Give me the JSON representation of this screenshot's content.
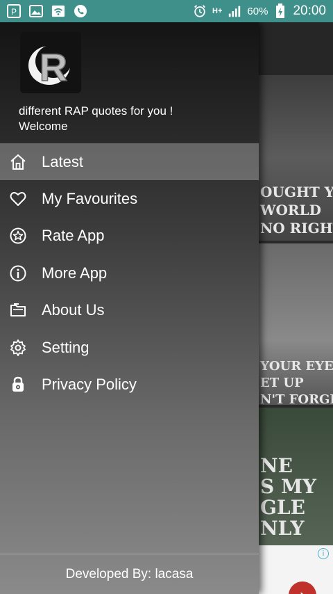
{
  "status_bar": {
    "battery_percent": "60%",
    "time": "20:00",
    "network": "H+"
  },
  "drawer": {
    "header": {
      "line1": "different RAP quotes for you !",
      "line2": "Welcome"
    },
    "menu": [
      {
        "label": "Latest",
        "icon": "home-icon",
        "active": true
      },
      {
        "label": "My Favourites",
        "icon": "heart-icon",
        "active": false
      },
      {
        "label": "Rate App",
        "icon": "star-icon",
        "active": false
      },
      {
        "label": "More App",
        "icon": "info-icon",
        "active": false
      },
      {
        "label": "About Us",
        "icon": "folder-icon",
        "active": false
      },
      {
        "label": "Setting",
        "icon": "gear-icon",
        "active": false
      },
      {
        "label": "Privacy Policy",
        "icon": "lock-icon",
        "active": false
      }
    ],
    "footer": "Developed By: lacasa"
  },
  "background_content": {
    "quote1": [
      "OUGHT YOU",
      "WORLD",
      "NO RIGHT"
    ],
    "quote2": [
      "YOUR EYES,",
      "ET UP",
      "N'T FORGET"
    ],
    "quote3": [
      "NE",
      "S MY",
      "GLE",
      "NLY"
    ]
  },
  "colors": {
    "status_bar": "#3f8f8b",
    "active_item": "rgba(255,255,255,0.28)",
    "ad_button": "#c0312b"
  }
}
